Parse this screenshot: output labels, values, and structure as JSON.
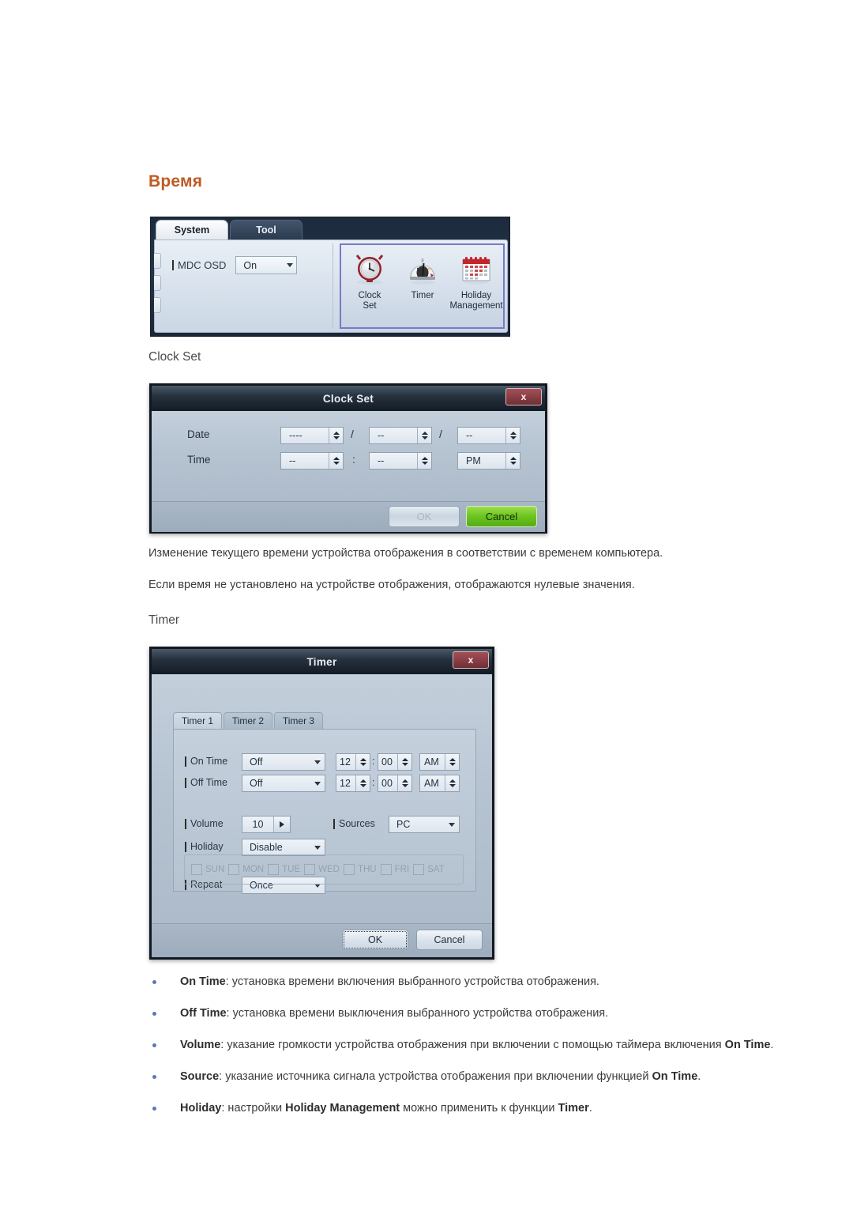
{
  "page": {
    "heading": "Время",
    "subheads": {
      "clock_set": "Clock Set",
      "timer": "Timer"
    },
    "paragraphs": [
      "Изменение текущего времени устройства отображения в соответствии с временем компьютера.",
      "Если время не установлено на устройстве отображения, отображаются нулевые значения."
    ],
    "heading_color": "#c05a22",
    "bullet_color": "#5b78b8"
  },
  "ribbon": {
    "tabs": [
      {
        "label": "System",
        "active": true
      },
      {
        "label": "Tool",
        "active": false
      }
    ],
    "mdc_osd": {
      "label": "MDC OSD",
      "value": "On"
    },
    "icons": [
      {
        "name": "clock-set",
        "label_line1": "Clock",
        "label_line2": "Set"
      },
      {
        "name": "timer",
        "label_line1": "Timer",
        "label_line2": ""
      },
      {
        "name": "holiday-management",
        "label_line1": "Holiday",
        "label_line2": "Management"
      }
    ],
    "highlight_color": "#7b79c6"
  },
  "clock_set_dialog": {
    "title": "Clock Set",
    "close_label": "x",
    "date": {
      "label": "Date",
      "year": "----",
      "month": "--",
      "day": "--",
      "separator": "/"
    },
    "time": {
      "label": "Time",
      "hour": "--",
      "minute": "--",
      "meridiem": "PM",
      "separator": ":"
    },
    "buttons": {
      "ok": "OK",
      "ok_disabled": true,
      "cancel": "Cancel",
      "cancel_color": "#6ec622"
    }
  },
  "timer_dialog": {
    "title": "Timer",
    "close_label": "x",
    "tabs": [
      {
        "label": "Timer 1",
        "active": true
      },
      {
        "label": "Timer 2",
        "active": false
      },
      {
        "label": "Timer 3",
        "active": false
      }
    ],
    "on_time": {
      "label": "On Time",
      "state": "Off",
      "hour": "12",
      "minute": "00",
      "meridiem": "AM",
      "separator": ":"
    },
    "off_time": {
      "label": "Off Time",
      "state": "Off",
      "hour": "12",
      "minute": "00",
      "meridiem": "AM",
      "separator": ":"
    },
    "volume": {
      "label": "Volume",
      "value": "10"
    },
    "sources": {
      "label": "Sources",
      "value": "PC"
    },
    "holiday": {
      "label": "Holiday",
      "value": "Disable"
    },
    "repeat": {
      "label": "Repeat",
      "value": "Once"
    },
    "days": [
      {
        "label": "SUN",
        "checked": false
      },
      {
        "label": "MON",
        "checked": false
      },
      {
        "label": "TUE",
        "checked": false
      },
      {
        "label": "WED",
        "checked": false
      },
      {
        "label": "THU",
        "checked": false
      },
      {
        "label": "FRI",
        "checked": false
      },
      {
        "label": "SAT",
        "checked": false
      }
    ],
    "buttons": {
      "ok": "OK",
      "cancel": "Cancel"
    }
  },
  "bullets": [
    {
      "term": "On Time",
      "text": ": установка времени включения выбранного устройства отображения."
    },
    {
      "term": "Off Time",
      "text": ": установка времени выключения выбранного устройства отображения."
    },
    {
      "term": "Volume",
      "text": ": указание громкости устройства отображения при включении с помощью таймера включения ",
      "term2": "On Time",
      "tail": "."
    },
    {
      "term": "Source",
      "text": ": указание источника сигнала устройства отображения при включении функцией ",
      "term2": "On Time",
      "tail": "."
    },
    {
      "term": "Holiday",
      "text": ": настройки ",
      "term2": "Holiday Management",
      "text2": " можно применить к функции ",
      "term3": "Timer",
      "tail": "."
    }
  ]
}
